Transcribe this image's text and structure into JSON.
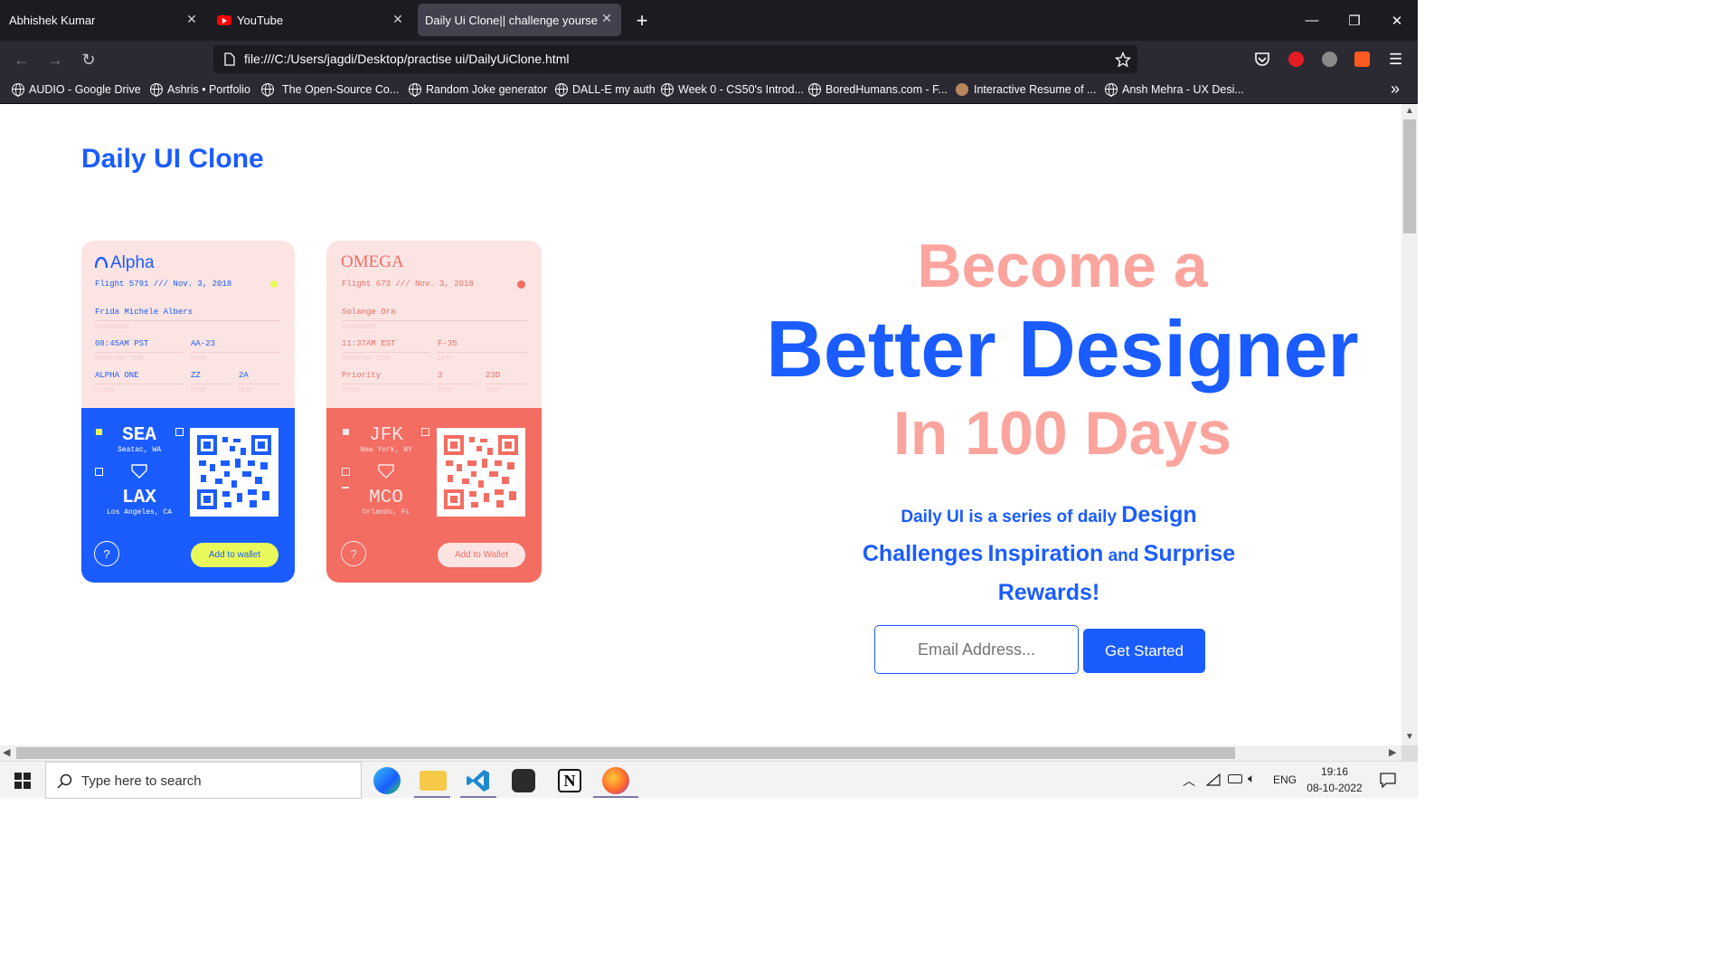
{
  "browser": {
    "tabs": [
      {
        "label": "Abhishek Kumar",
        "active": false
      },
      {
        "label": "YouTube",
        "active": false,
        "icon": "youtube-icon"
      },
      {
        "label": "Daily Ui Clone|| challenge yourself [",
        "active": true
      }
    ],
    "new_tab": "+",
    "url": "file:///C:/Users/jagdi/Desktop/practise ui/DailyUiClone.html",
    "bookmarks": [
      "AUDIO - Google Drive",
      "Ashris • Portfolio",
      "The Open-Source Co...",
      "Random Joke generator",
      "DALL-E my auth",
      "Week 0 - CS50's Introd...",
      "BoredHumans.com - F...",
      "Interactive Resume of ...",
      "Ansh Mehra - UX Desi..."
    ]
  },
  "page": {
    "brand": "Daily UI Clone",
    "hero": {
      "line1": "Become a",
      "line2": "Better Designer",
      "line3": "In 100 Days"
    },
    "description": {
      "part1": "Daily UI is a series of daily",
      "part2": "Design",
      "part3": "Challenges",
      "part4": "Inspiration",
      "part5": "and",
      "part6": "Surprise",
      "part7": "Rewards!"
    },
    "email_placeholder": "Email Address...",
    "cta": "Get Started",
    "cards": [
      {
        "airline": "Alpha",
        "flight": "Flight 5791 /// Nov. 3, 2018",
        "passenger": "Frida Michele Albers",
        "passenger_label": "PASSENGER",
        "boarding_time": "08:45AM PST",
        "boarding_label": "BOARDING TIME",
        "gate": "AA-23",
        "gate_label": "GATE",
        "class": "ALPHA ONE",
        "class_label": "CLASS",
        "zone": "ZZ",
        "zone_label": "ZONE",
        "seat": "2A",
        "seat_label": "SEAT",
        "from_code": "SEA",
        "from_city": "Seatac, WA",
        "to_code": "LAX",
        "to_city": "Los Angeles, CA",
        "wallet": "Add to wallet",
        "help": "?"
      },
      {
        "airline": "OMEGA",
        "flight": "Flight 673 /// Nov. 3, 2018",
        "passenger": "Solange Ora",
        "passenger_label": "PASSENGER",
        "boarding_time": "11:37AM EST",
        "boarding_label": "BOARDING TIME",
        "gate": "F-35",
        "gate_label": "GATE",
        "class": "Priority",
        "class_label": "CLASS",
        "zone": "3",
        "zone_label": "ZONE",
        "seat": "23D",
        "seat_label": "SEAT",
        "from_code": "JFK",
        "from_city": "New York, NY",
        "to_code": "MCO",
        "to_city": "Orlando, FL",
        "wallet": "Add to Wallet",
        "help": "?"
      }
    ]
  },
  "taskbar": {
    "search_placeholder": "Type here to search",
    "lang": "ENG",
    "time": "19:16",
    "date": "08-10-2022"
  },
  "colors": {
    "blue": "#1a5cff",
    "salmon": "#fba59e",
    "card2": "#f36d62",
    "yellow": "#e9f95a"
  }
}
